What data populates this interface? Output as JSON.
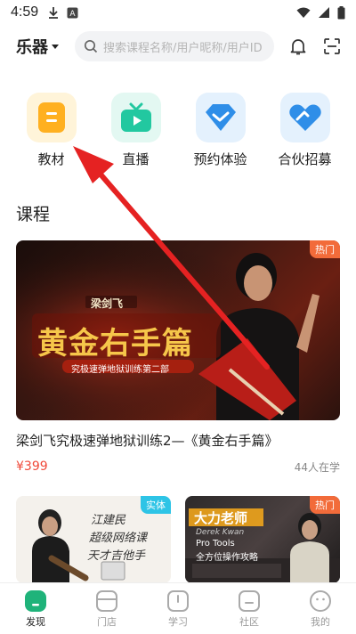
{
  "status_bar": {
    "time": "4:59"
  },
  "header": {
    "category": "乐器",
    "search_placeholder": "搜索课程名称/用户昵称/用户ID"
  },
  "quick_entries": [
    {
      "label": "教材",
      "icon": "book-icon",
      "color": "#ffb020",
      "bg": "#fff4d9"
    },
    {
      "label": "直播",
      "icon": "tv-play-icon",
      "color": "#22c8a0",
      "bg": "#e3f8f2"
    },
    {
      "label": "预约体验",
      "icon": "diamond-check-icon",
      "color": "#2f8ee8",
      "bg": "#e4f1fd"
    },
    {
      "label": "合伙招募",
      "icon": "partner-icon",
      "color": "#2f8ee8",
      "bg": "#e4f1fd"
    }
  ],
  "courses": {
    "section_title": "课程",
    "featured": {
      "badge": "热门",
      "banner_text_brand": "梁剑飞",
      "banner_text_title": "黄金右手篇",
      "banner_text_sub": "究极速弹地狱训练第二部",
      "title": "梁剑飞究极速弹地狱训练2—《黄金右手篇》",
      "price": "¥399",
      "learners": "44人在学"
    },
    "cards": [
      {
        "badge": "实体",
        "handwriting": [
          "江建民",
          "超级网络课",
          "天才吉他手"
        ]
      },
      {
        "badge": "热门",
        "heading": "大力老师",
        "sub1": "Derek Kwan",
        "sub2": "Pro Tools",
        "sub3": "全方位操作攻略"
      }
    ]
  },
  "bottom_nav": [
    {
      "label": "发现",
      "icon": "discover-icon",
      "active": true
    },
    {
      "label": "门店",
      "icon": "store-icon",
      "active": false
    },
    {
      "label": "学习",
      "icon": "study-icon",
      "active": false
    },
    {
      "label": "社区",
      "icon": "community-icon",
      "active": false
    },
    {
      "label": "我的",
      "icon": "profile-icon",
      "active": false
    }
  ],
  "colors": {
    "accent": "#1fb37a",
    "price": "#f04a3a",
    "arrow": "#e52222"
  }
}
